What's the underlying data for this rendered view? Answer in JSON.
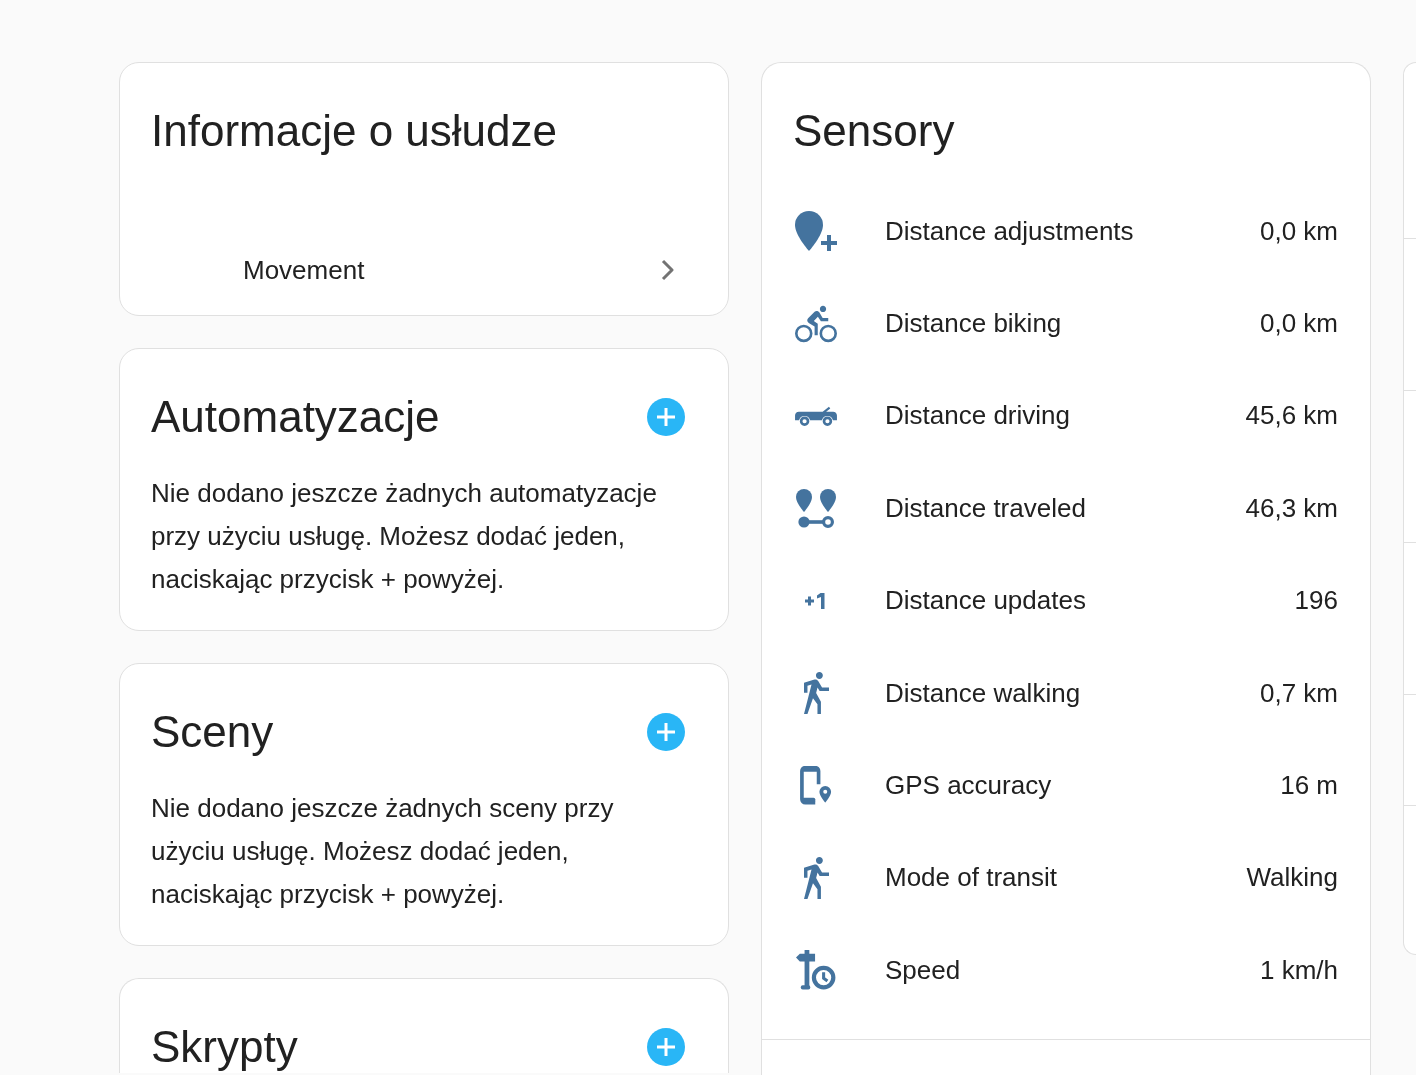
{
  "cards": [
    {
      "kind": "device_info",
      "title": "Informacje o usłudze",
      "devices": [
        {
          "name": "Movement"
        }
      ]
    },
    {
      "kind": "add_section",
      "title": "Automatyzacje",
      "empty_text": "Nie dodano jeszcze żadnych automatyzacje przy użyciu usługę. Możesz dodać jeden, naciskając przycisk + powyżej."
    },
    {
      "kind": "add_section",
      "title": "Sceny",
      "empty_text": "Nie dodano jeszcze żadnych sceny przy użyciu usługę. Możesz dodać jeden, naciskając przycisk + powyżej."
    },
    {
      "kind": "add_section",
      "title": "Skrypty"
    }
  ],
  "sensors_card": {
    "title": "Sensory",
    "entities": [
      {
        "name": "Distance adjustments",
        "value": "0,0 km"
      },
      {
        "name": "Distance biking",
        "value": "0,0 km"
      },
      {
        "name": "Distance driving",
        "value": "45,6 km"
      },
      {
        "name": "Distance traveled",
        "value": "46,3 km"
      },
      {
        "name": "Distance updates",
        "value": "196"
      },
      {
        "name": "Distance walking",
        "value": "0,7 km"
      },
      {
        "name": "GPS accuracy",
        "value": "16 m"
      },
      {
        "name": "Mode of transit",
        "value": "Walking"
      },
      {
        "name": "Speed",
        "value": "1 km/h"
      }
    ]
  }
}
